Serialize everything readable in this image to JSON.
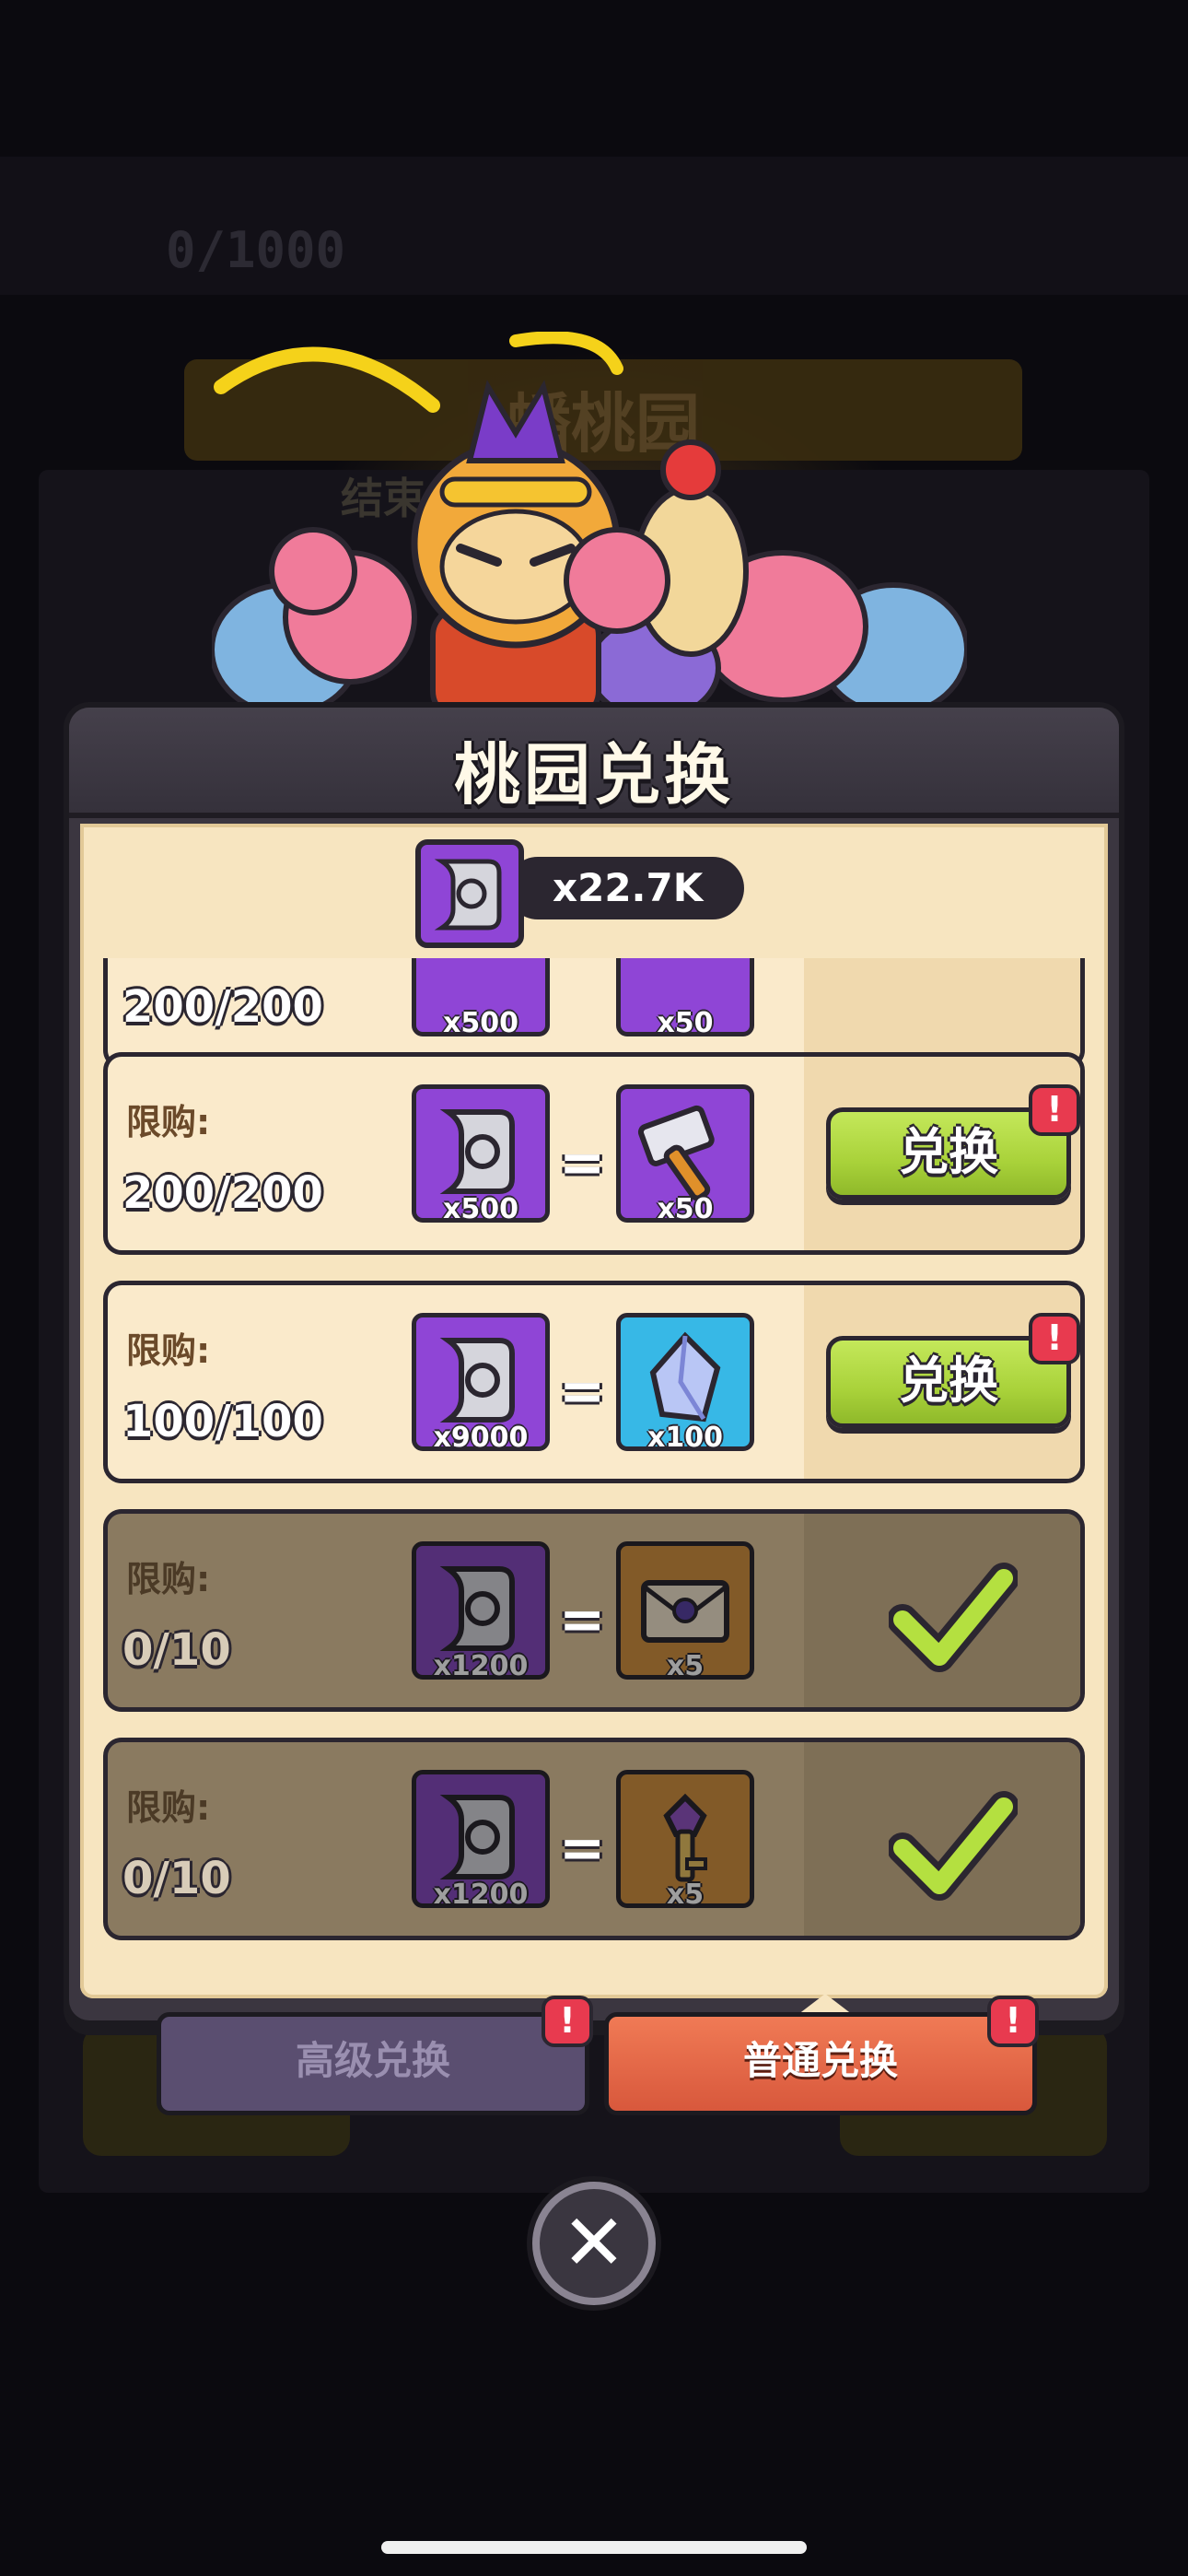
{
  "background": {
    "counter": "0/1000",
    "banner_title": "蟠桃园",
    "timer_text": "结束"
  },
  "modal": {
    "title": "桃园兑换",
    "balance": {
      "icon": "scroll-currency-icon",
      "amount": "x22.7K"
    },
    "partial_row": {
      "limit_value": "200/200",
      "cost_count": "x500",
      "reward_count": "x50"
    },
    "rows": [
      {
        "limit_label": "限购:",
        "limit_value": "200/200",
        "cost_icon": "scroll-currency-icon",
        "cost_count": "x500",
        "equals": "=",
        "reward_icon": "hammer-icon",
        "reward_count": "x50",
        "reward_color": "#8f45d6",
        "button_label": "兑换",
        "badge": "!",
        "state": "available"
      },
      {
        "limit_label": "限购:",
        "limit_value": "100/100",
        "cost_icon": "scroll-currency-icon",
        "cost_count": "x9000",
        "equals": "=",
        "reward_icon": "crystal-icon",
        "reward_count": "x100",
        "reward_color": "#37b8e6",
        "button_label": "兑换",
        "badge": "!",
        "state": "available"
      },
      {
        "limit_label": "限购:",
        "limit_value": "0/10",
        "cost_icon": "scroll-currency-icon",
        "cost_count": "x1200",
        "equals": "=",
        "reward_icon": "envelope-icon",
        "reward_count": "x5",
        "reward_color": "#e0902a",
        "state": "completed"
      },
      {
        "limit_label": "限购:",
        "limit_value": "0/10",
        "cost_icon": "scroll-currency-icon",
        "cost_count": "x1200",
        "equals": "=",
        "reward_icon": "key-icon",
        "reward_count": "x5",
        "reward_color": "#e0902a",
        "state": "completed"
      }
    ]
  },
  "tabs": {
    "advanced": {
      "label": "高级兑换",
      "badge": "!"
    },
    "normal": {
      "label": "普通兑换",
      "badge": "!",
      "active": true
    }
  },
  "close_label": "✕",
  "colors": {
    "accent_green": "#a9d23a",
    "badge_red": "#e83a4f",
    "panel_cream": "#f7e5c0",
    "tab_active": "#e8663f",
    "tab_inactive": "#5a4e70"
  }
}
